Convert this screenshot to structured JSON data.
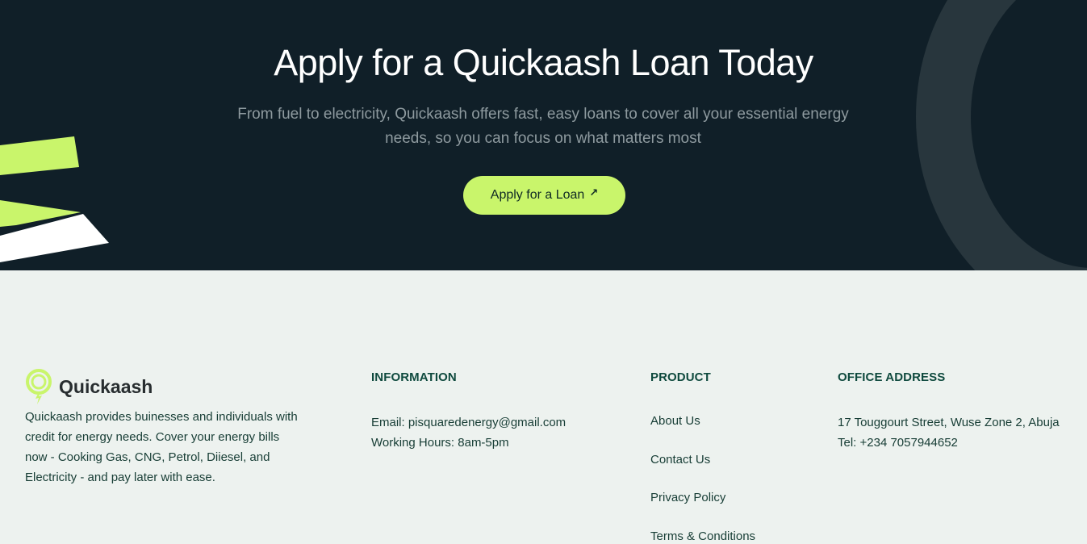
{
  "hero": {
    "title": "Apply for a Quickaash Loan Today",
    "subtitle": "From fuel to electricity, Quickaash offers fast, easy loans to cover all your essential energy needs, so you can focus on what matters most",
    "cta_label": "Apply for a Loan",
    "cta_icon": "arrow-up-right-icon",
    "colors": {
      "background": "#101f28",
      "accent": "#c9f56b",
      "ring": "#28363d"
    }
  },
  "footer": {
    "brand": {
      "name": "Quickaash",
      "description": "Quickaash provides buinesses and individuals with credit for energy needs. Cover your energy bills now - Cooking Gas, CNG, Petrol, Diiesel, and Electricity - and pay later with ease."
    },
    "information": {
      "heading": "INFORMATION",
      "email": "Email: pisquaredenergy@gmail.com",
      "hours": "Working Hours: 8am-5pm"
    },
    "product": {
      "heading": "PRODUCT",
      "links": [
        "About Us",
        "Contact Us",
        "Privacy Policy",
        "Terms & Conditions"
      ]
    },
    "office": {
      "heading": "OFFICE ADDRESS",
      "address": "17 Touggourt Street, Wuse Zone 2, Abuja",
      "phone": "Tel: +234 7057944652"
    },
    "colors": {
      "background": "#edf2ef",
      "heading": "#0f4a3e",
      "text": "#173d35"
    }
  }
}
